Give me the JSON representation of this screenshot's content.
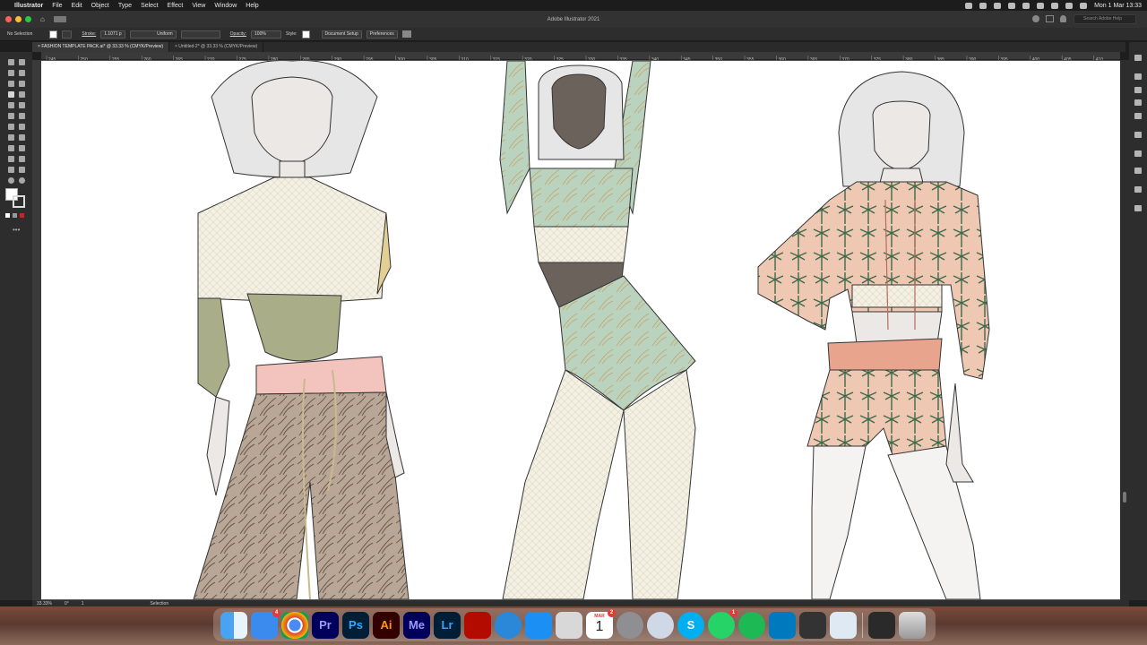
{
  "menubar": {
    "app_name": "Illustrator",
    "items": [
      "File",
      "Edit",
      "Object",
      "Type",
      "Select",
      "Effect",
      "View",
      "Window",
      "Help"
    ],
    "clock": "Mon 1 Mar  13:33"
  },
  "window": {
    "title": "Adobe Illustrator 2021",
    "search_placeholder": "Search Adobe Help"
  },
  "controlbar": {
    "selection_label": "No Selection",
    "stroke_label": "Stroke:",
    "stroke_value": "1.1071 p",
    "stroke_profile": "Uniform",
    "opacity_label": "Opacity:",
    "opacity_value": "100%",
    "style_label": "Style:",
    "document_setup": "Document Setup",
    "preferences": "Preferences"
  },
  "tabs": [
    {
      "label": "FASHION TEMPLATE PACK.ai* @ 33.33 % (CMYK/Preview)",
      "active": true
    },
    {
      "label": "Untitled-2* @ 33.33 % (CMYK/Preview)",
      "active": false
    }
  ],
  "ruler": {
    "ticks": [
      "245",
      "250",
      "255",
      "260",
      "265",
      "270",
      "275",
      "280",
      "285",
      "290",
      "295",
      "300",
      "305",
      "310",
      "315",
      "320",
      "325",
      "330",
      "335",
      "340",
      "345",
      "350",
      "355",
      "360",
      "365",
      "370",
      "375",
      "380",
      "385",
      "390",
      "395",
      "400",
      "405",
      "410"
    ]
  },
  "status": {
    "zoom": "33.33%",
    "rotation": "0°",
    "artboard": "1",
    "tool": "Selection"
  },
  "dock": {
    "apps": [
      {
        "name": "Finder",
        "label": ""
      },
      {
        "name": "Mail",
        "label": "",
        "badge": "4"
      },
      {
        "name": "Chrome",
        "label": ""
      },
      {
        "name": "Premiere Pro",
        "label": "Pr"
      },
      {
        "name": "Photoshop",
        "label": "Ps"
      },
      {
        "name": "Illustrator",
        "label": "Ai"
      },
      {
        "name": "Media Encoder",
        "label": "Me"
      },
      {
        "name": "Lightroom",
        "label": "Lr"
      },
      {
        "name": "Acrobat",
        "label": ""
      },
      {
        "name": "Wunderlist",
        "label": ""
      },
      {
        "name": "App Store",
        "label": ""
      },
      {
        "name": "Calculator",
        "label": ""
      },
      {
        "name": "Calendar",
        "label": "1",
        "month": "MAR",
        "badge": "2"
      },
      {
        "name": "System Preferences",
        "label": ""
      },
      {
        "name": "Proxyman",
        "label": ""
      },
      {
        "name": "Skype",
        "label": "S"
      },
      {
        "name": "WhatsApp",
        "label": "",
        "badge": "1"
      },
      {
        "name": "Spotify",
        "label": ""
      },
      {
        "name": "Trello",
        "label": ""
      },
      {
        "name": "Sublime Text",
        "label": ""
      },
      {
        "name": "Preview",
        "label": ""
      }
    ],
    "recent": [
      {
        "name": "Screenshot"
      },
      {
        "name": "Trash"
      }
    ]
  },
  "colors": {
    "accent_green": "#b9d3bf",
    "skin_dark": "#6b625c",
    "olive": "#a9ae88",
    "coral": "#e8a48d",
    "pink_rib": "#f2c4bd",
    "cream": "#f4f1e4"
  }
}
